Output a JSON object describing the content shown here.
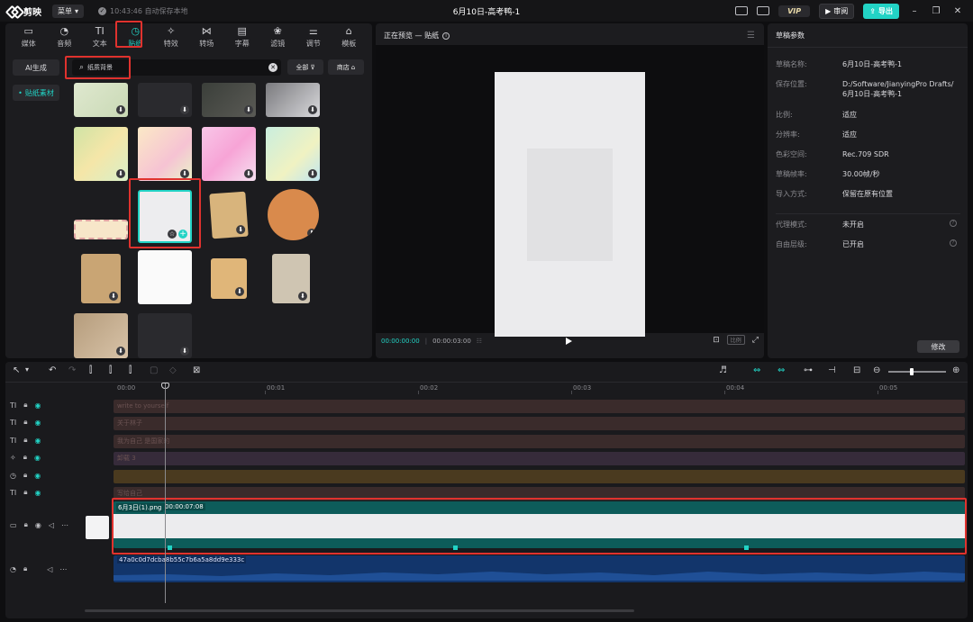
{
  "app": {
    "menu_label": "菜单",
    "autosave": "10:43:46 自动保存本地",
    "project_title": "6月10日-高考鸭-1",
    "vip": "VIP",
    "review": "审阅",
    "export": "导出"
  },
  "tabs": [
    {
      "label": "媒体",
      "icon": "▭"
    },
    {
      "label": "音频",
      "icon": "◔"
    },
    {
      "label": "文本",
      "icon": "TI"
    },
    {
      "label": "贴纸",
      "icon": "◷"
    },
    {
      "label": "特效",
      "icon": "✧"
    },
    {
      "label": "转场",
      "icon": "⋈"
    },
    {
      "label": "字幕",
      "icon": "▤"
    },
    {
      "label": "滤镜",
      "icon": "❀"
    },
    {
      "label": "调节",
      "icon": "⚌"
    },
    {
      "label": "模板",
      "icon": "⌂"
    }
  ],
  "side_nav": {
    "ai": "AI生成",
    "current": "贴纸素材"
  },
  "search": {
    "value": "纸质背景",
    "placeholder": "纸质背景"
  },
  "filter": {
    "all": "全部",
    "shop": "商店"
  },
  "preview": {
    "title": "正在预览 — 贴纸",
    "current_time": "00:00:00:00",
    "total_time": "00:00:03:00",
    "ratio_chip": "比例"
  },
  "props": {
    "title": "草稿参数",
    "rows": [
      {
        "label": "草稿名称:",
        "value": "6月10日-高考鸭-1"
      },
      {
        "label": "保存位置:",
        "value": "D:/Software/JianyingPro Drafts/",
        "value2": "6月10日-高考鸭-1"
      },
      {
        "label": "比例:",
        "value": "适应"
      },
      {
        "label": "分辨率:",
        "value": "适应"
      },
      {
        "label": "色彩空间:",
        "value": "Rec.709 SDR"
      },
      {
        "label": "草稿帧率:",
        "value": "30.00帧/秒"
      },
      {
        "label": "导入方式:",
        "value": "保留在原有位置"
      },
      {
        "label": "代理模式:",
        "value": "未开启"
      },
      {
        "label": "自由层级:",
        "value": "已开启"
      }
    ],
    "modify": "修改"
  },
  "timeline": {
    "ruler": [
      "00:00",
      "00:01",
      "00:02",
      "00:03",
      "00:04",
      "00:05"
    ],
    "text_tracks": [
      "write to yourself",
      "关于林子",
      "我为自己 是国家的",
      "卸载 3",
      "",
      "写给自己"
    ],
    "main_clip": {
      "name": "6月3日(1).png",
      "duration": "00:00:07:08"
    },
    "audio_clip": {
      "name": "47a0c0d7dcba8b55c7b6a5a8dd9e333c"
    }
  },
  "colors": {
    "accent": "#22d3c5",
    "highlight": "#e0322e"
  }
}
